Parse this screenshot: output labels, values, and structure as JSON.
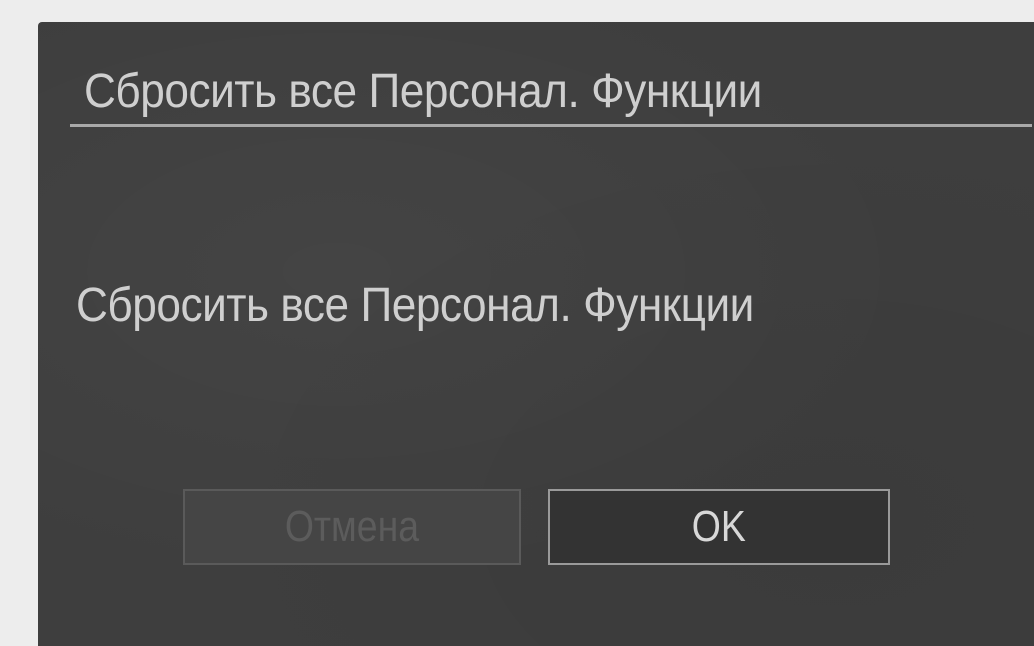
{
  "dialog": {
    "title": "Сбросить все Персонал. Функции",
    "message": "Сбросить все Персонал. Функции",
    "buttons": {
      "cancel_label": "Отмена",
      "ok_label": "OK"
    },
    "selected_button": "ok",
    "colors": {
      "screen_bg": "#3e3e3e",
      "text": "#cfcfcf",
      "selected_button_bg": "#333333",
      "disabled_text": "#5c5c5c"
    }
  }
}
